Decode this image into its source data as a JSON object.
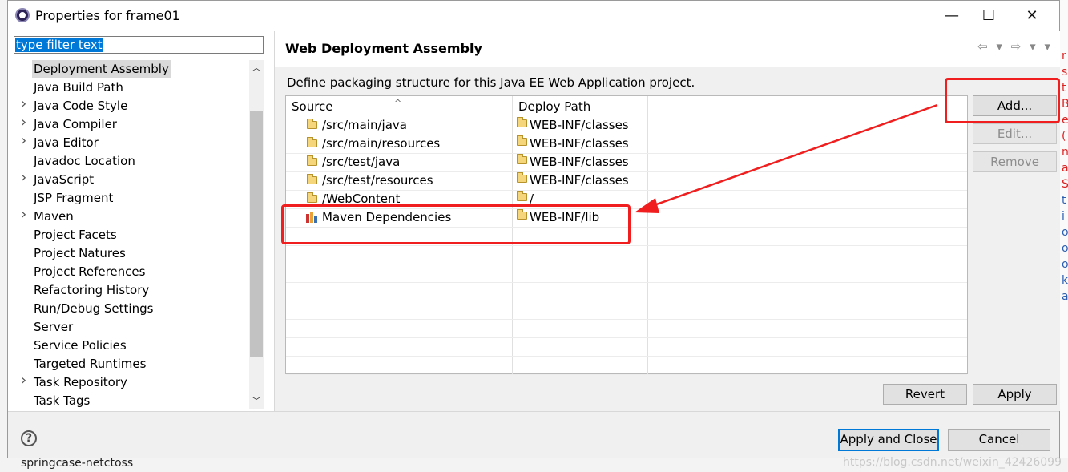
{
  "window": {
    "title": "Properties for frame01",
    "minimize": "—",
    "maximize": "☐",
    "close": "✕"
  },
  "filter": {
    "value": "type filter text"
  },
  "tree": {
    "items": [
      {
        "label": "Deployment Assembly",
        "expandable": false,
        "selected": true
      },
      {
        "label": "Java Build Path",
        "expandable": false
      },
      {
        "label": "Java Code Style",
        "expandable": true
      },
      {
        "label": "Java Compiler",
        "expandable": true
      },
      {
        "label": "Java Editor",
        "expandable": true
      },
      {
        "label": "Javadoc Location",
        "expandable": false
      },
      {
        "label": "JavaScript",
        "expandable": true
      },
      {
        "label": "JSP Fragment",
        "expandable": false
      },
      {
        "label": "Maven",
        "expandable": true
      },
      {
        "label": "Project Facets",
        "expandable": false
      },
      {
        "label": "Project Natures",
        "expandable": false
      },
      {
        "label": "Project References",
        "expandable": false
      },
      {
        "label": "Refactoring History",
        "expandable": false
      },
      {
        "label": "Run/Debug Settings",
        "expandable": false
      },
      {
        "label": "Server",
        "expandable": false
      },
      {
        "label": "Service Policies",
        "expandable": false
      },
      {
        "label": "Targeted Runtimes",
        "expandable": false
      },
      {
        "label": "Task Repository",
        "expandable": true
      },
      {
        "label": "Task Tags",
        "expandable": false
      }
    ]
  },
  "page": {
    "title": "Web Deployment Assembly",
    "description": "Define packaging structure for this Java EE Web Application project.",
    "columns": {
      "source": "Source",
      "deploy_path": "Deploy Path"
    },
    "rows": [
      {
        "source": "/src/main/java",
        "deploy": "WEB-INF/classes",
        "icon": "folder-icon"
      },
      {
        "source": "/src/main/resources",
        "deploy": "WEB-INF/classes",
        "icon": "folder-icon"
      },
      {
        "source": "/src/test/java",
        "deploy": "WEB-INF/classes",
        "icon": "folder-icon"
      },
      {
        "source": "/src/test/resources",
        "deploy": "WEB-INF/classes",
        "icon": "folder-icon"
      },
      {
        "source": "/WebContent",
        "deploy": "/",
        "icon": "folder-icon"
      },
      {
        "source": "Maven Dependencies",
        "deploy": "WEB-INF/lib",
        "icon": "library-icon"
      }
    ],
    "buttons": {
      "add": "Add...",
      "edit": "Edit...",
      "remove": "Remove",
      "revert": "Revert",
      "apply": "Apply"
    }
  },
  "footer": {
    "help": "?",
    "apply_close": "Apply and Close",
    "cancel": "Cancel"
  },
  "background": {
    "project_name": "springcase-netctoss",
    "watermark": "https://blog.csdn.net/weixin_42426099",
    "right_letters": [
      "r",
      "s",
      "t",
      "B",
      "e",
      "(",
      "n",
      "a",
      "S",
      "t",
      "i",
      "o",
      "o",
      "o",
      "k",
      "a"
    ]
  },
  "colors": {
    "annotation": "#f01e1e",
    "selection": "#0078d7"
  }
}
